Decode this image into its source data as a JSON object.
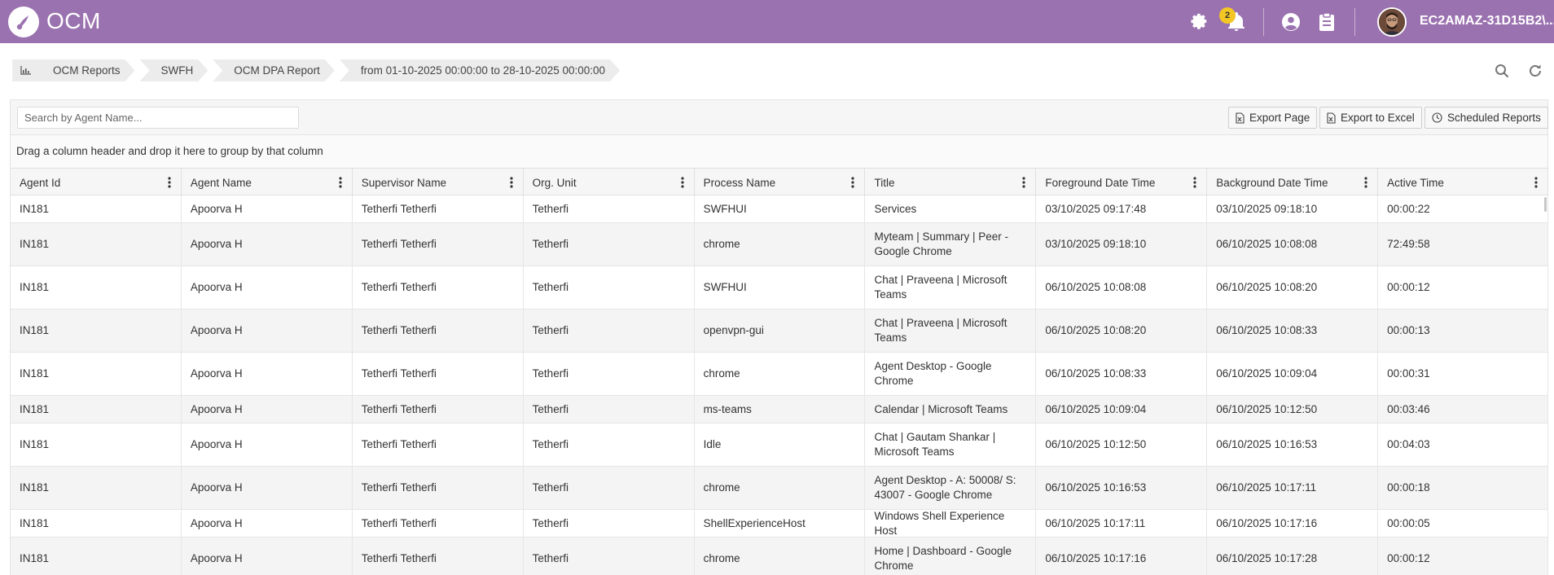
{
  "header": {
    "app_name": "OCM",
    "notification_count": "2",
    "user_name": "EC2AMAZ-31D15B2\\...",
    "brand_color": "#9b72b0"
  },
  "breadcrumb": {
    "items": [
      "OCM Reports",
      "SWFH",
      "OCM DPA Report",
      "from 01-10-2025 00:00:00 to 28-10-2025 00:00:00"
    ]
  },
  "toolbar": {
    "search_placeholder": "Search by Agent Name...",
    "export_page": "Export Page",
    "export_excel": "Export to Excel",
    "scheduled_reports": "Scheduled Reports"
  },
  "group_panel": {
    "hint": "Drag a column header and drop it here to group by that column"
  },
  "table": {
    "columns": [
      "Agent Id",
      "Agent Name",
      "Supervisor Name",
      "Org. Unit",
      "Process Name",
      "Title",
      "Foreground Date Time",
      "Background Date Time",
      "Active Time"
    ],
    "rows": [
      [
        "IN181",
        "Apoorva H",
        "Tetherfi Tetherfi",
        "Tetherfi",
        "SWFHUI",
        "Services",
        "03/10/2025 09:17:48",
        "03/10/2025 09:18:10",
        "00:00:22"
      ],
      [
        "IN181",
        "Apoorva H",
        "Tetherfi Tetherfi",
        "Tetherfi",
        "chrome",
        "Myteam | Summary | Peer - Google Chrome",
        "03/10/2025 09:18:10",
        "06/10/2025 10:08:08",
        "72:49:58"
      ],
      [
        "IN181",
        "Apoorva H",
        "Tetherfi Tetherfi",
        "Tetherfi",
        "SWFHUI",
        "Chat | Praveena | Microsoft Teams",
        "06/10/2025 10:08:08",
        "06/10/2025 10:08:20",
        "00:00:12"
      ],
      [
        "IN181",
        "Apoorva H",
        "Tetherfi Tetherfi",
        "Tetherfi",
        "openvpn-gui",
        "Chat | Praveena | Microsoft Teams",
        "06/10/2025 10:08:20",
        "06/10/2025 10:08:33",
        "00:00:13"
      ],
      [
        "IN181",
        "Apoorva H",
        "Tetherfi Tetherfi",
        "Tetherfi",
        "chrome",
        "Agent Desktop - Google Chrome",
        "06/10/2025 10:08:33",
        "06/10/2025 10:09:04",
        "00:00:31"
      ],
      [
        "IN181",
        "Apoorva H",
        "Tetherfi Tetherfi",
        "Tetherfi",
        "ms-teams",
        "Calendar | Microsoft Teams",
        "06/10/2025 10:09:04",
        "06/10/2025 10:12:50",
        "00:03:46"
      ],
      [
        "IN181",
        "Apoorva H",
        "Tetherfi Tetherfi",
        "Tetherfi",
        "Idle",
        "Chat | Gautam Shankar | Microsoft Teams",
        "06/10/2025 10:12:50",
        "06/10/2025 10:16:53",
        "00:04:03"
      ],
      [
        "IN181",
        "Apoorva H",
        "Tetherfi Tetherfi",
        "Tetherfi",
        "chrome",
        "Agent Desktop - A: 50008/ S: 43007 - Google Chrome",
        "06/10/2025 10:16:53",
        "06/10/2025 10:17:11",
        "00:00:18"
      ],
      [
        "IN181",
        "Apoorva H",
        "Tetherfi Tetherfi",
        "Tetherfi",
        "ShellExperienceHost",
        "Windows Shell Experience Host",
        "06/10/2025 10:17:11",
        "06/10/2025 10:17:16",
        "00:00:05"
      ],
      [
        "IN181",
        "Apoorva H",
        "Tetherfi Tetherfi",
        "Tetherfi",
        "chrome",
        "Home | Dashboard - Google Chrome",
        "06/10/2025 10:17:16",
        "06/10/2025 10:17:28",
        "00:00:12"
      ]
    ]
  }
}
